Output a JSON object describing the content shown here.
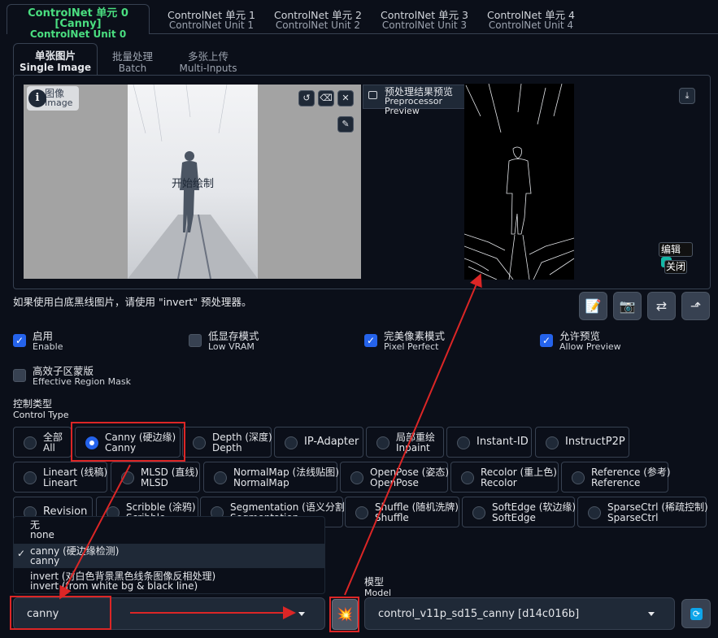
{
  "unit_tabs": [
    {
      "l1": "ControlNet 单元 0 [Canny]",
      "l2": "ControlNet Unit 0"
    },
    {
      "l1": "ControlNet 单元 1",
      "l2": "ControlNet Unit 1"
    },
    {
      "l1": "ControlNet 单元 2",
      "l2": "ControlNet Unit 2"
    },
    {
      "l1": "ControlNet 单元 3",
      "l2": "ControlNet Unit 3"
    },
    {
      "l1": "ControlNet 单元 4",
      "l2": "ControlNet Unit 4"
    }
  ],
  "input_tabs": [
    {
      "l1": "单张图片",
      "l2": "Single Image"
    },
    {
      "l1": "批量处理",
      "l2": "Batch"
    },
    {
      "l1": "多张上传",
      "l2": "Multi-Inputs"
    }
  ],
  "image_panel": {
    "label_zh": "图像",
    "label_en": "Image",
    "overlay_text": "开始绘制"
  },
  "preview_panel": {
    "label_zh": "预处理结果预览",
    "label_en": "Preprocessor Preview",
    "edit_label": "编辑",
    "close_label": "关闭"
  },
  "hint_text": "如果使用白底黑线图片，请使用 \"invert\" 预处理器。",
  "checkboxes": [
    {
      "zh": "启用",
      "en": "Enable",
      "checked": true
    },
    {
      "zh": "低显存模式",
      "en": "Low VRAM",
      "checked": false
    },
    {
      "zh": "完美像素模式",
      "en": "Pixel Perfect",
      "checked": true
    },
    {
      "zh": "允许预览",
      "en": "Allow Preview",
      "checked": true
    },
    {
      "zh": "高效子区蒙版",
      "en": "Effective Region Mask",
      "checked": false
    }
  ],
  "control_type": {
    "label_zh": "控制类型",
    "label_en": "Control Type",
    "options": [
      {
        "zh": "全部",
        "en": "All"
      },
      {
        "zh": "Canny (硬边缘)",
        "en": "Canny"
      },
      {
        "zh": "Depth (深度)",
        "en": "Depth"
      },
      {
        "zh": "IP-Adapter",
        "en": ""
      },
      {
        "zh": "局部重绘",
        "en": "Inpaint"
      },
      {
        "zh": "Instant-ID",
        "en": ""
      },
      {
        "zh": "InstructP2P",
        "en": ""
      },
      {
        "zh": "Lineart (线稿)",
        "en": "Lineart"
      },
      {
        "zh": "MLSD (直线)",
        "en": "MLSD"
      },
      {
        "zh": "NormalMap (法线贴图)",
        "en": "NormalMap"
      },
      {
        "zh": "OpenPose (姿态)",
        "en": "OpenPose"
      },
      {
        "zh": "Recolor (重上色)",
        "en": "Recolor"
      },
      {
        "zh": "Reference (参考)",
        "en": "Reference"
      },
      {
        "zh": "Revision",
        "en": ""
      },
      {
        "zh": "Scribble (涂鸦)",
        "en": "Scribble"
      },
      {
        "zh": "Segmentation (语义分割)",
        "en": "Segmentation"
      },
      {
        "zh": "Shuffle (随机洗牌)",
        "en": "Shuffle"
      },
      {
        "zh": "SoftEdge (软边缘)",
        "en": "SoftEdge"
      },
      {
        "zh": "SparseCtrl (稀疏控制)",
        "en": "SparseCtrl"
      }
    ],
    "selected": "Canny"
  },
  "preprocessor_dropdown": {
    "options": [
      {
        "zh": "无",
        "en": "none"
      },
      {
        "zh": "canny (硬边缘检测)",
        "en": "canny"
      },
      {
        "zh": "invert (对白色背景黑色线条图像反相处理)",
        "en": "invert (from white bg & black line)"
      }
    ],
    "selected_mark": "✓",
    "value": "canny",
    "arrow": "chevron-down-icon"
  },
  "run_icon": "explosion-icon",
  "model": {
    "label_zh": "模型",
    "label_en": "Model",
    "value": "control_v11p_sd15_canny [d14c016b]"
  },
  "colors": {
    "accent_green": "#4ade80",
    "checkbox_blue": "#2563eb",
    "annotation_red": "#dc2626"
  }
}
